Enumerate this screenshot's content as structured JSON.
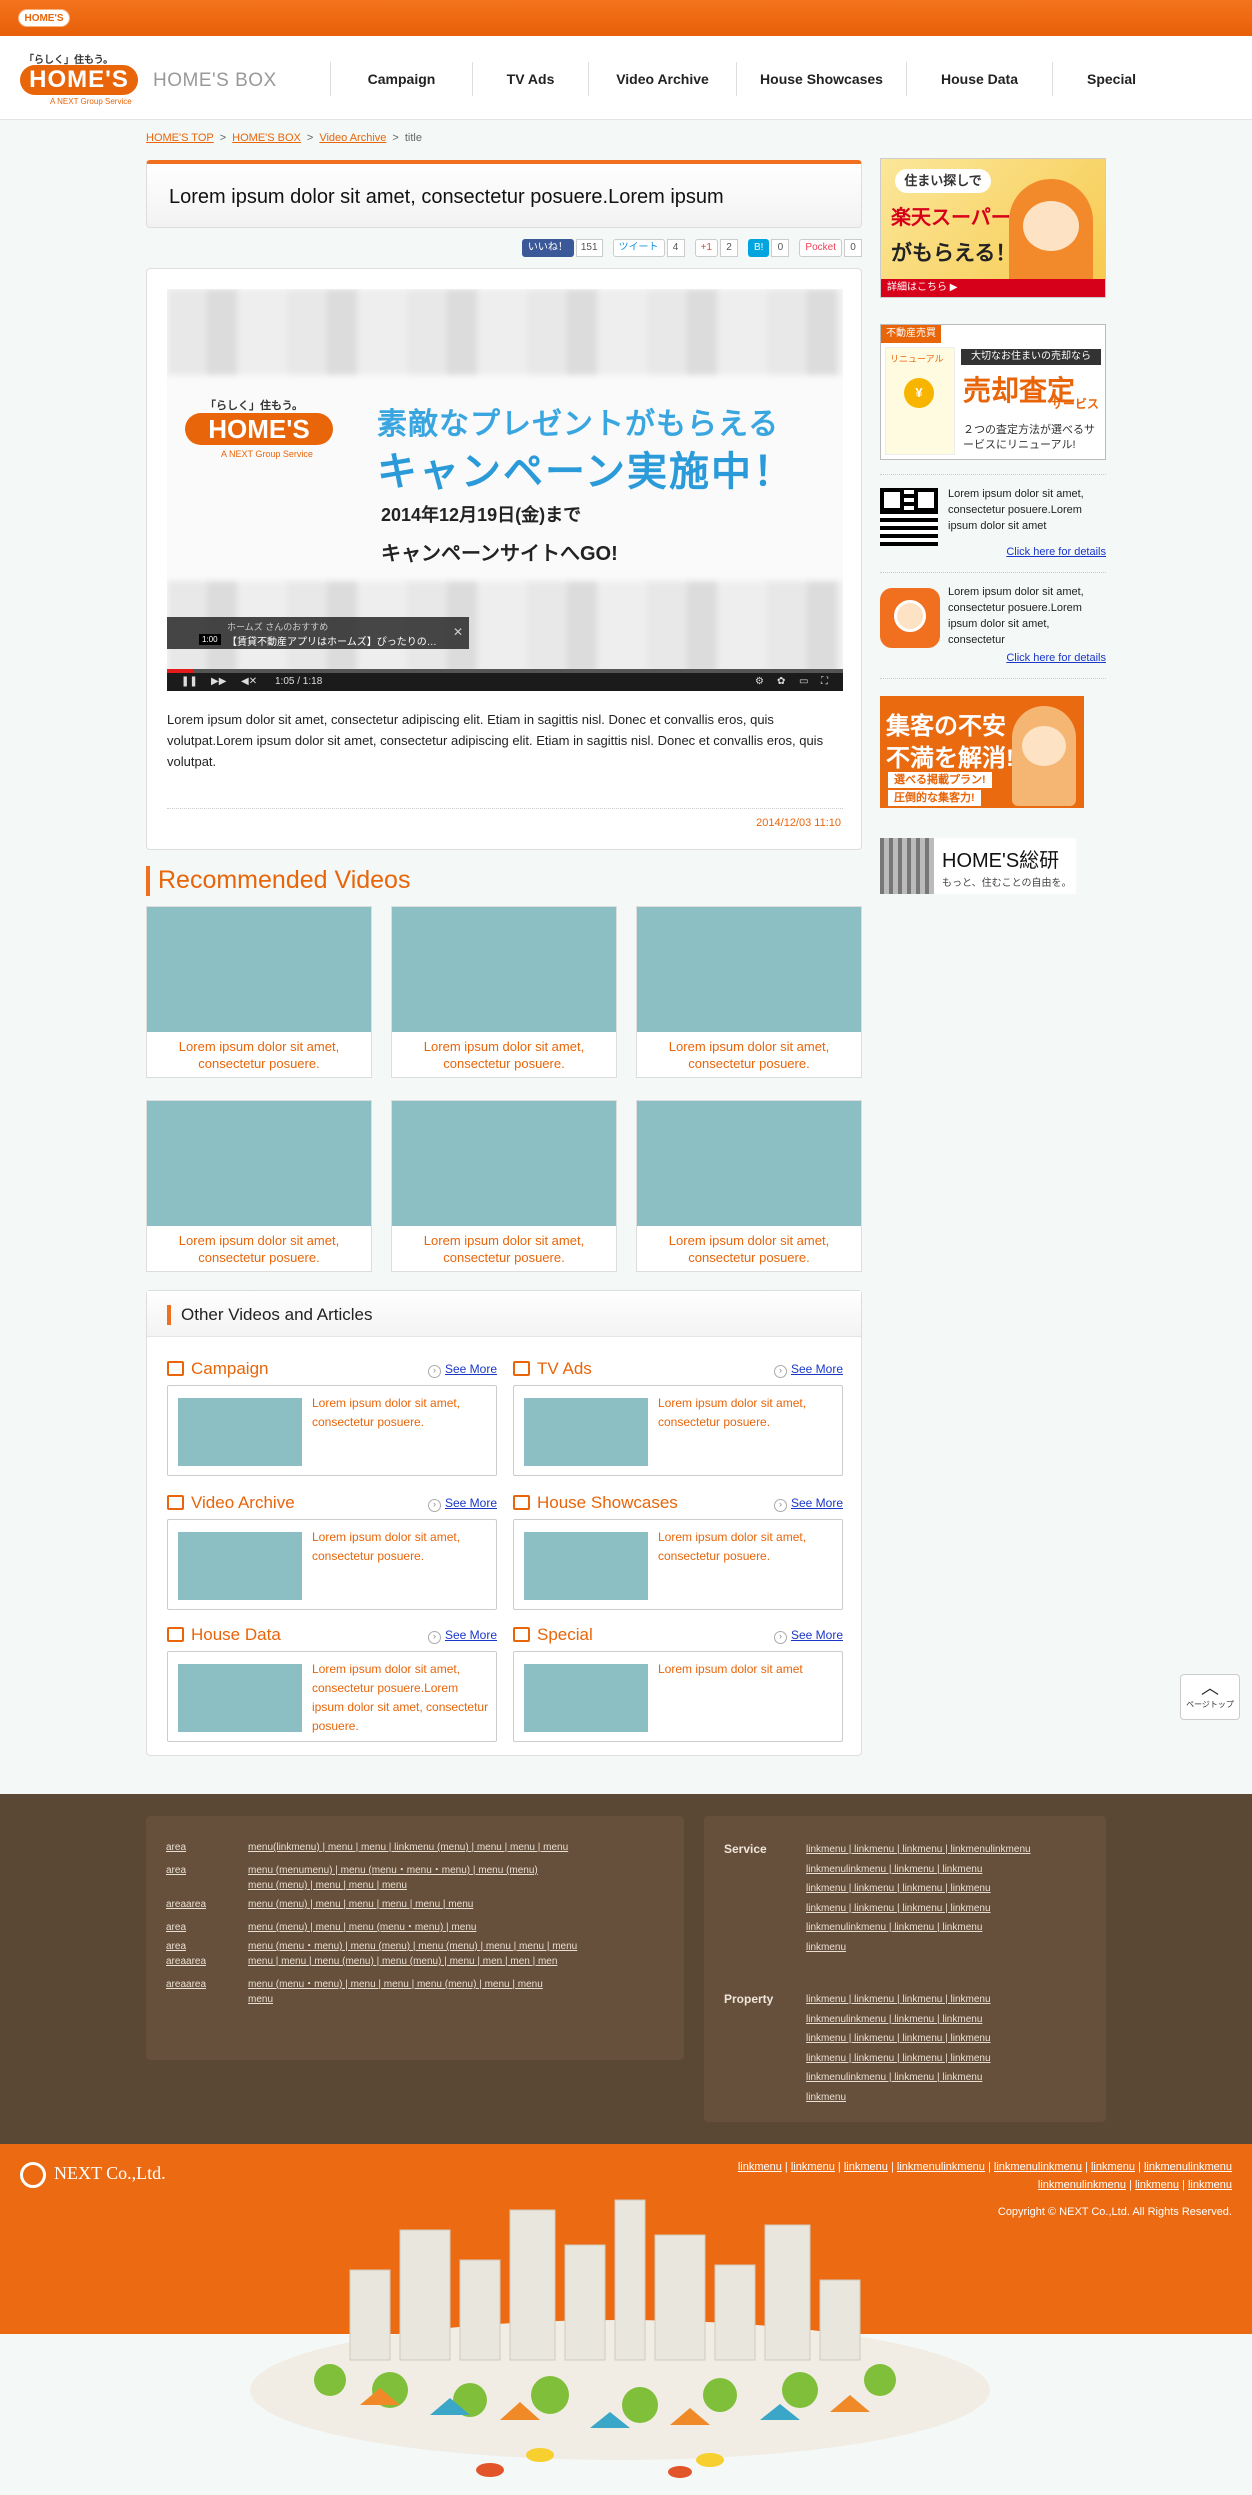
{
  "brand": {
    "mini_logo": "HOME'S",
    "logo_tag": "「らしく」住もう。",
    "logo_name": "HOME'S",
    "logo_sub": "A NEXT Group Service",
    "section_title": "HOME'S BOX"
  },
  "nav": [
    "Campaign",
    "TV Ads",
    "Video Archive",
    "House Showcases",
    "House Data",
    "Special"
  ],
  "breadcrumb": {
    "home": "HOME'S TOP",
    "box": "HOME'S BOX",
    "archive": "Video Archive",
    "current": "title",
    "sep": ">"
  },
  "article": {
    "title": "Lorem ipsum dolor sit amet, consectetur posuere.Lorem ipsum",
    "body": "Lorem ipsum dolor sit amet, consectetur adipiscing elit. Etiam in sagittis nisl. Donec et convallis eros, quis volutpat.Lorem ipsum dolor sit amet, consectetur adipiscing elit. Etiam in sagittis nisl. Donec et convallis eros, quis volutpat.",
    "date": "2014/12/03 11:10"
  },
  "social": {
    "fb_label": "いいね！",
    "fb_count": "151",
    "tw_label": "ツイート",
    "tw_count": "4",
    "gp_label": "+1",
    "gp_count": "2",
    "hb_label": "B!",
    "hb_count": "0",
    "pk_label": "Pocket",
    "pk_count": "0"
  },
  "video": {
    "logo_tag": "「らしく」住もう。",
    "logo_name": "HOME'S",
    "logo_sub": "A NEXT Group Service",
    "promo1": "素敵なプレゼントがもらえる",
    "promo2": "キャンペーン実施中！",
    "promo3": "2014年12月19日(金)まで",
    "promo4": "キャンペーンサイトへGO!",
    "overlay_channel": "ホームズ さんのおすすめ",
    "overlay_title": "【賃貸不動産アプリはホームズ】ぴったりの…",
    "overlay_duration": "1:00",
    "time": "1:05 / 1:18",
    "progress": 0.04
  },
  "recommended": {
    "heading": "Recommended Videos",
    "items": [
      "Lorem ipsum dolor sit amet, consectetur posuere.",
      "Lorem ipsum dolor sit amet, consectetur posuere.",
      "Lorem ipsum dolor sit amet, consectetur posuere.",
      "Lorem ipsum dolor sit amet, consectetur posuere.",
      "Lorem ipsum dolor sit amet, consectetur posuere.",
      "Lorem ipsum dolor sit amet, consectetur posuere."
    ]
  },
  "other": {
    "heading": "Other Videos and Articles",
    "see_more": "See More",
    "sections": [
      {
        "name": "Campaign",
        "icon": "monitor-icon",
        "text": "Lorem ipsum dolor sit amet, consectetur posuere."
      },
      {
        "name": "TV Ads",
        "icon": "tv-icon",
        "text": "Lorem ipsum dolor sit amet, consectetur posuere."
      },
      {
        "name": "Video Archive",
        "icon": "play-icon",
        "text": "Lorem ipsum dolor sit amet, consectetur posuere."
      },
      {
        "name": "House Showcases",
        "icon": "house-icon",
        "text": "Lorem ipsum dolor sit amet, consectetur posuere."
      },
      {
        "name": "House Data",
        "icon": "chart-icon",
        "text": "Lorem ipsum dolor sit amet, consectetur posuere.Lorem ipsum dolor sit amet, consectetur posuere."
      },
      {
        "name": "Special",
        "icon": "gift-icon",
        "text": "Lorem ipsum dolor sit amet"
      }
    ]
  },
  "side": {
    "ad1": {
      "bubble": "住まい探しで",
      "line1": "楽天スーパーポイント",
      "line2": "がもらえる！",
      "footer": "詳細はこちら ▶"
    },
    "ad2": {
      "head": "不動産売買",
      "renewal": "リニューアル",
      "coin": "¥",
      "top": "大切なお住まいの売却なら",
      "big": "売却査定",
      "service": "サービス",
      "desc": "２つの査定方法が選べるサービスにリニューアル!"
    },
    "qr_text": "Lorem ipsum dolor sit amet, consectetur posuere.Lorem ipsum dolor sit amet",
    "app_text": "Lorem ipsum dolor sit amet, consectetur posuere.Lorem ipsum dolor sit amet, consectetur",
    "details": "Click here for details",
    "ad3": {
      "line1": "集客の不安",
      "line2": "不満を解消!!",
      "b1": "選べる掲載プラン!",
      "b2": "圧倒的な集客力!"
    },
    "ad4": {
      "title": "HOME'S総研",
      "sub": "もっと、住むことの自由を。"
    }
  },
  "pagetop": {
    "arrow": "︿",
    "label": "ページトップ"
  },
  "footer": {
    "areas": [
      {
        "k": "area",
        "v": "menu(linkmenu) | menu | menu | linkmenu (menu) | menu | menu | menu"
      },
      {
        "k": "area",
        "v": "menu (menumenu) | menu (menu・menu・menu) | menu (menu)"
      },
      {
        "k": "",
        "v": "menu (menu) | menu | menu | menu"
      },
      {
        "k": "areaarea",
        "v": "menu (menu) | menu | menu | menu | menu | menu"
      },
      {
        "k": "area",
        "v": "menu (menu) | menu | menu (menu・menu) | menu"
      },
      {
        "k": "area",
        "v": "menu (menu・menu) | menu (menu) | menu (menu) | menu | menu | menu"
      },
      {
        "k": "areaarea",
        "v": "menu | menu | menu (menu) | menu (menu) | menu | men | men | men"
      },
      {
        "k": "areaarea",
        "v": "menu (menu・menu) | menu | menu | menu (menu) | menu | menu"
      },
      {
        "k": "",
        "v": "menu"
      }
    ],
    "service_label": "Service",
    "service_lines": [
      "linkmenu | linkmenu | linkmenu | linkmenulinkmenu",
      "linkmenulinkmenu | linkmenu | linkmenu",
      "linkmenu | linkmenu | linkmenu | linkmenu",
      "linkmenu | linkmenu | linkmenu | linkmenu",
      "linkmenulinkmenu | linkmenu | linkmenu",
      "linkmenu"
    ],
    "property_label": "Property",
    "property_lines": [
      "linkmenu | linkmenu | linkmenu | linkmenu",
      "linkmenulinkmenu | linkmenu | linkmenu",
      "linkmenu | linkmenu | linkmenu | linkmenu",
      "linkmenu | linkmenu | linkmenu | linkmenu",
      "linkmenulinkmenu | linkmenu | linkmenu",
      "linkmenu"
    ]
  },
  "bottom": {
    "company": "NEXT Co.,Ltd.",
    "links1": [
      "linkmenu",
      "linkmenu",
      "linkmenu",
      "linkmenulinkmenu",
      "linkmenulinkmenu",
      "linkmenu",
      "linkmenulinkmenu"
    ],
    "links2": [
      "linkmenulinkmenu",
      "linkmenu",
      "linkmenu"
    ],
    "copyright": "Copyright © NEXT Co.,Ltd. All Rights Reserved."
  }
}
